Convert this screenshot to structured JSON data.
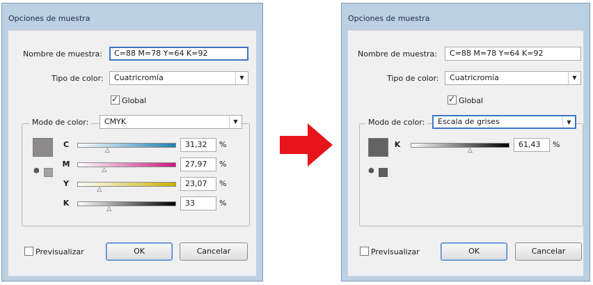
{
  "left_dialog": {
    "title": "Opciones de muestra",
    "name_label": "Nombre de muestra:",
    "name_value": "C=88 M=78 Y=64 K=92",
    "type_label": "Tipo de color:",
    "type_value": "Cuatricromía",
    "global_label": "Global",
    "global_checked": true,
    "mode_label": "Modo de color:",
    "mode_value": "CMYK",
    "swatch_color": "#8c8a8a",
    "channels": [
      {
        "letter": "C",
        "value": "31,32",
        "level": 0.313,
        "gradient": "#1f7fb3"
      },
      {
        "letter": "M",
        "value": "27,97",
        "level": 0.28,
        "gradient": "#c8197a"
      },
      {
        "letter": "Y",
        "value": "23,07",
        "level": 0.231,
        "gradient": "#c9b200"
      },
      {
        "letter": "K",
        "value": "33",
        "level": 0.33,
        "gradient": "#000000"
      }
    ],
    "percent_sign": "%",
    "preview_label": "Previsualizar",
    "ok_label": "OK",
    "cancel_label": "Cancelar"
  },
  "right_dialog": {
    "title": "Opciones de muestra",
    "name_label": "Nombre de muestra:",
    "name_value": "C=88 M=78 Y=64 K=92",
    "type_label": "Tipo de color:",
    "type_value": "Cuatricromía",
    "global_label": "Global",
    "global_checked": true,
    "mode_label": "Modo de color:",
    "mode_value": "Escala de grises",
    "swatch_color": "#636363",
    "channels": [
      {
        "letter": "K",
        "value": "61,43",
        "level": 0.614,
        "gradient": "#000000"
      }
    ],
    "percent_sign": "%",
    "preview_label": "Previsualizar",
    "ok_label": "OK",
    "cancel_label": "Cancelar"
  },
  "arrow_color": "#e8141b"
}
